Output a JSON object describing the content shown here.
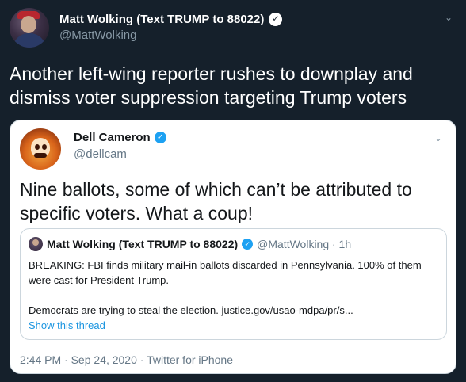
{
  "outer_tweet": {
    "author_name": "Matt Wolking (Text TRUMP to 88022)",
    "verified_icon": "verified-badge-icon",
    "author_handle": "@MattWolking",
    "text": "Another left-wing reporter rushes to downplay and dismiss voter suppression targeting Trump voters"
  },
  "quoted_tweet": {
    "author_name": "Dell Cameron",
    "author_handle": "@dellcam",
    "text": "Nine ballots, some of which can’t be attributed to specific voters. What a coup!",
    "timestamp": "2:44 PM · Sep 24, 2020 · Twitter for iPhone",
    "embedded": {
      "author_name": "Matt Wolking (Text TRUMP to 88022)",
      "meta": "@MattWolking · 1h",
      "line1": "BREAKING: FBI finds military mail-in ballots discarded in Pennsylvania. 100% of them were cast for President Trump.",
      "line2": "Democrats are trying to steal the election. justice.gov/usao-mdpa/pr/s...",
      "show_thread": "Show this thread"
    }
  },
  "colors": {
    "background": "#15202b",
    "card": "#ffffff",
    "accent": "#1da1f2",
    "muted": "#8899a6"
  }
}
